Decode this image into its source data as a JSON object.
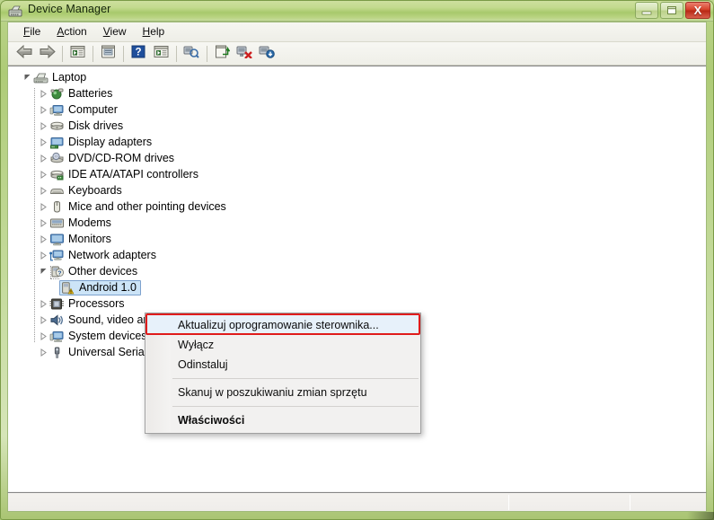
{
  "window": {
    "title": "Device Manager",
    "icon": "device-manager-icon",
    "buttons": {
      "minimize": "minimize-icon",
      "maximize": "maximize-icon",
      "close": "X"
    }
  },
  "menu_bar": {
    "items": [
      {
        "label": "File",
        "accel": "F"
      },
      {
        "label": "Action",
        "accel": "A"
      },
      {
        "label": "View",
        "accel": "V"
      },
      {
        "label": "Help",
        "accel": "H"
      }
    ]
  },
  "toolbar": {
    "buttons": [
      {
        "name": "back-icon",
        "tooltip": "Back"
      },
      {
        "name": "forward-icon",
        "tooltip": "Forward"
      },
      {
        "name": "show-hide-console-tree-icon",
        "tooltip": "Show/Hide Console Tree"
      },
      {
        "name": "properties-icon",
        "tooltip": "Properties"
      },
      {
        "name": "help-icon",
        "tooltip": "Help"
      },
      {
        "name": "show-hide-action-pane-icon",
        "tooltip": "Show/Hide Action Pane"
      },
      {
        "name": "scan-for-hardware-changes-icon",
        "tooltip": "Scan for hardware changes"
      },
      {
        "name": "update-driver-icon",
        "tooltip": "Update Driver Software"
      },
      {
        "name": "uninstall-device-icon",
        "tooltip": "Uninstall"
      },
      {
        "name": "disable-enable-device-icon",
        "tooltip": "Disable/Enable"
      }
    ]
  },
  "tree": {
    "root": {
      "label": "Laptop",
      "icon": "computer-laptop-icon",
      "expanded": true
    },
    "items": [
      {
        "label": "Batteries",
        "icon": "battery-icon",
        "expandable": true,
        "level": 1
      },
      {
        "label": "Computer",
        "icon": "computer-icon",
        "expandable": true,
        "level": 1
      },
      {
        "label": "Disk drives",
        "icon": "disk-drive-icon",
        "expandable": true,
        "level": 1
      },
      {
        "label": "Display adapters",
        "icon": "display-adapter-icon",
        "expandable": true,
        "level": 1
      },
      {
        "label": "DVD/CD-ROM drives",
        "icon": "dvd-drive-icon",
        "expandable": true,
        "level": 1
      },
      {
        "label": "IDE ATA/ATAPI controllers",
        "icon": "ide-controller-icon",
        "expandable": true,
        "level": 1
      },
      {
        "label": "Keyboards",
        "icon": "keyboard-icon",
        "expandable": true,
        "level": 1
      },
      {
        "label": "Mice and other pointing devices",
        "icon": "mouse-icon",
        "expandable": true,
        "level": 1
      },
      {
        "label": "Modems",
        "icon": "modem-icon",
        "expandable": true,
        "level": 1
      },
      {
        "label": "Monitors",
        "icon": "monitor-icon",
        "expandable": true,
        "level": 1
      },
      {
        "label": "Network adapters",
        "icon": "network-adapter-icon",
        "expandable": true,
        "level": 1
      },
      {
        "label": "Other devices",
        "icon": "other-devices-icon",
        "expandable": true,
        "level": 1,
        "expanded": true
      },
      {
        "label": "Android 1.0",
        "icon": "unknown-device-warning-icon",
        "expandable": false,
        "level": 2,
        "selected": true,
        "warning": true
      },
      {
        "label": "Processors",
        "icon": "processor-icon",
        "expandable": true,
        "level": 1
      },
      {
        "label": "Sound, video and game controllers",
        "icon": "sound-icon",
        "expandable": true,
        "level": 1
      },
      {
        "label": "System devices",
        "icon": "system-device-icon",
        "expandable": true,
        "level": 1
      },
      {
        "label": "Universal Serial Bus controllers",
        "icon": "usb-icon",
        "expandable": true,
        "level": 1
      }
    ]
  },
  "context_menu": {
    "items": [
      {
        "label": "Aktualizuj oprogramowanie sterownika...",
        "highlighted": true,
        "bold": false,
        "separator_after": false
      },
      {
        "label": "Wyłącz",
        "highlighted": false,
        "bold": false,
        "separator_after": false
      },
      {
        "label": "Odinstaluj",
        "highlighted": false,
        "bold": false,
        "separator_after": true
      },
      {
        "label": "Skanuj w poszukiwaniu zmian sprzętu",
        "highlighted": false,
        "bold": false,
        "separator_after": true
      },
      {
        "label": "Właściwości",
        "highlighted": false,
        "bold": true,
        "separator_after": false
      }
    ]
  },
  "annotation": {
    "shape": "rectangle",
    "color": "#e01b1b",
    "target": "Aktualizuj oprogramowanie sterownika..."
  },
  "status_bar": {
    "panes": [
      "",
      "",
      ""
    ]
  },
  "colors": {
    "frame_green": "#b6d184",
    "title_text": "#14240a",
    "close_red": "#d9472f",
    "selection_blue": "#cce4f7",
    "annotation_red": "#e01b1b",
    "panel_white": "#ffffff"
  }
}
